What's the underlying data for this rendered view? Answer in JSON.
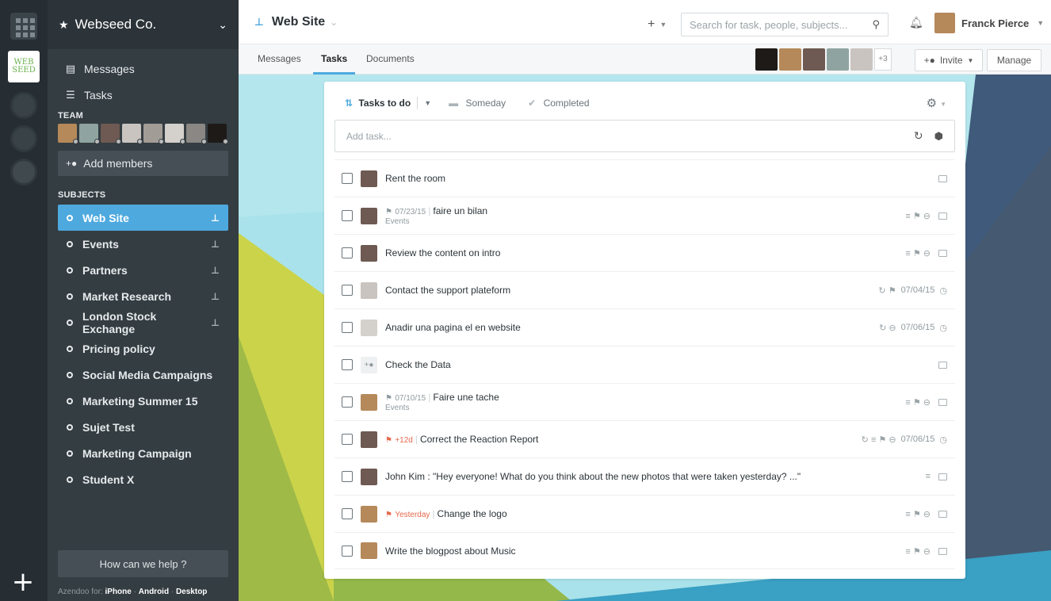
{
  "rail": {
    "logo_line1": "WEB",
    "logo_line2": "SEED"
  },
  "sidebar": {
    "org_name": "Webseed Co.",
    "nav": [
      {
        "label": "Messages"
      },
      {
        "label": "Tasks"
      }
    ],
    "team_label": "TEAM",
    "add_members_label": "Add members",
    "subjects_label": "SUBJECTS",
    "subjects": [
      {
        "label": "Web Site",
        "active": true,
        "pinned": true
      },
      {
        "label": "Events",
        "pinned": true
      },
      {
        "label": "Partners",
        "pinned": true
      },
      {
        "label": "Market Research",
        "pinned": true
      },
      {
        "label": "London Stock Exchange",
        "pinned": true
      },
      {
        "label": "Pricing policy"
      },
      {
        "label": "Social Media Campaigns"
      },
      {
        "label": "Marketing Summer 15"
      },
      {
        "label": "Sujet Test"
      },
      {
        "label": "Marketing Campaign"
      },
      {
        "label": "Student X"
      }
    ],
    "help_label": "How can we help ?",
    "apps_prefix": "Azendoo for:",
    "apps": [
      "iPhone",
      "Android",
      "Desktop"
    ]
  },
  "topbar": {
    "workspace_title": "Web Site",
    "search_placeholder": "Search for task, people, subjects...",
    "user_name": "Franck Pierce"
  },
  "tabs": {
    "messages": "Messages",
    "tasks": "Tasks",
    "documents": "Documents",
    "extra_members": "+3",
    "invite": "Invite",
    "manage": "Manage"
  },
  "panel": {
    "filter_todo": "Tasks to do",
    "filter_someday": "Someday",
    "filter_completed": "Completed",
    "add_task_placeholder": "Add task...",
    "tasks": [
      {
        "title": "Rent the room",
        "flag": "",
        "sub": "",
        "meta": "",
        "date": ""
      },
      {
        "title": "faire un bilan",
        "flag": "07/23/15",
        "sub": "Events",
        "meta": "≡ ⚑ ⊖",
        "date": ""
      },
      {
        "title": "Review the content on intro",
        "flag": "",
        "sub": "",
        "meta": "≡ ⚑ ⊖",
        "date": ""
      },
      {
        "title": "Contact the support plateform",
        "flag": "",
        "sub": "",
        "meta": "↻ ⚑",
        "date": "07/04/15"
      },
      {
        "title": "Anadir una pagina el en website",
        "flag": "",
        "sub": "",
        "meta": "↻ ⊖",
        "date": "07/06/15"
      },
      {
        "title": "Check the Data",
        "flag": "",
        "sub": "",
        "meta": "",
        "date": ""
      },
      {
        "title": "Faire une tache",
        "flag": "07/10/15",
        "sub": "Events",
        "meta": "≡ ⚑ ⊖",
        "date": ""
      },
      {
        "title": "Correct the Reaction Report",
        "flag": "+12d",
        "sub": "",
        "meta": "↻ ≡ ⚑ ⊖",
        "date": "07/06/15"
      },
      {
        "title": "John Kim : \"Hey everyone! What do you think about the new photos that were taken yesterday? ...\"",
        "flag": "",
        "sub": "",
        "meta": "≡",
        "date": ""
      },
      {
        "title": "Change the logo",
        "flag": "Yesterday",
        "sub": "",
        "meta": "≡ ⚑ ⊖",
        "date": ""
      },
      {
        "title": "Write the blogpost about Music",
        "flag": "",
        "sub": "",
        "meta": "≡ ⚑ ⊖",
        "date": ""
      }
    ]
  },
  "colors": {
    "accent": "#4ea9de",
    "sidebar_bg": "#343d42",
    "rail_bg": "#262e33",
    "late_flag": "#e6684b"
  }
}
